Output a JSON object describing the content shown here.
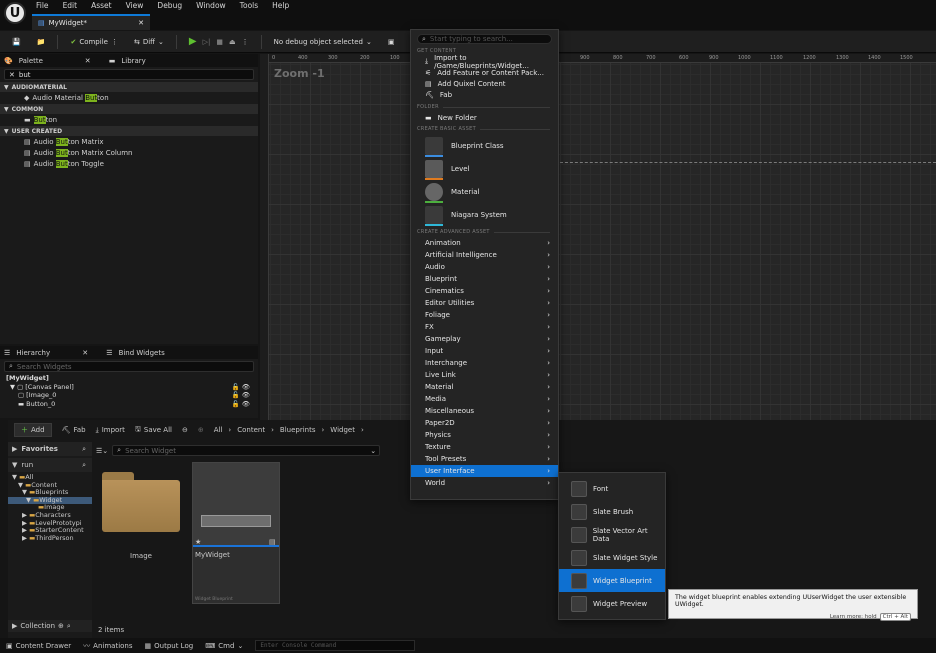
{
  "app": {
    "logo": "U",
    "menu": [
      "File",
      "Edit",
      "Asset",
      "View",
      "Debug",
      "Window",
      "Tools",
      "Help"
    ],
    "doc_tab": "MyWidget*"
  },
  "toolbar": {
    "compile": "Compile",
    "diff": "Diff",
    "debug_select": "No debug object selected"
  },
  "palette": {
    "title": "Palette",
    "library": "Library",
    "search": "but",
    "sections": [
      {
        "name": "AUDIOMATERIAL",
        "items": [
          {
            "pre": "Audio Material ",
            "hl": "But",
            "post": "ton"
          }
        ]
      },
      {
        "name": "COMMON",
        "items": [
          {
            "pre": "",
            "hl": "But",
            "post": "ton"
          }
        ]
      },
      {
        "name": "USER CREATED",
        "items": [
          {
            "pre": "Audio ",
            "hl": "But",
            "post": "ton Matrix"
          },
          {
            "pre": "Audio ",
            "hl": "But",
            "post": "ton Matrix Column"
          },
          {
            "pre": "Audio ",
            "hl": "But",
            "post": "ton Toggle"
          }
        ]
      }
    ]
  },
  "hierarchy": {
    "title": "Hierarchy",
    "bind": "Bind Widgets",
    "search_placeholder": "Search Widgets",
    "tree": [
      "[MyWidget]",
      "[Canvas Panel]",
      "[Image_0",
      "Button_0"
    ]
  },
  "designer": {
    "zoom": "Zoom -1",
    "ruler": [
      "0",
      "400",
      "300",
      "200",
      "100",
      "900",
      "800",
      "700",
      "600",
      "900",
      "1000",
      "1100",
      "1200",
      "1300",
      "1400",
      "1500"
    ]
  },
  "context_menu": {
    "search_placeholder": "Start typing to search...",
    "get_content_header": "GET CONTENT",
    "get_content": [
      "Import to /Game/Blueprints/Widget...",
      "Add Feature or Content Pack...",
      "Add Quixel Content",
      "Fab"
    ],
    "folder_header": "FOLDER",
    "new_folder": "New Folder",
    "basic_header": "CREATE BASIC ASSET",
    "basic": [
      "Blueprint Class",
      "Level",
      "Material",
      "Niagara System"
    ],
    "advanced_header": "CREATE ADVANCED ASSET",
    "advanced": [
      "Animation",
      "Artificial Intelligence",
      "Audio",
      "Blueprint",
      "Cinematics",
      "Editor Utilities",
      "Foliage",
      "FX",
      "Gameplay",
      "Input",
      "Interchange",
      "Live Link",
      "Material",
      "Media",
      "Miscellaneous",
      "Paper2D",
      "Physics",
      "Texture",
      "Tool Presets",
      "User Interface",
      "World"
    ],
    "highlighted": "User Interface"
  },
  "submenu": {
    "items": [
      "Font",
      "Slate Brush",
      "Slate Vector Art Data",
      "Slate Widget Style",
      "Widget Blueprint",
      "Widget Preview"
    ],
    "highlighted": "Widget Blueprint"
  },
  "tooltip": {
    "text": "The widget blueprint enables extending UUserWidget the user extensible UWidget.",
    "learn": "Learn more: hold",
    "keys": "Ctrl + Alt"
  },
  "content_browser": {
    "add": "Add",
    "fab": "Fab",
    "import": "Import",
    "save_all": "Save All",
    "path": [
      "All",
      "Content",
      "Blueprints",
      "Widget"
    ],
    "favorites": "Favorites",
    "filter_text": "run",
    "tree": [
      "All",
      "Content",
      "Blueprints",
      "Widget",
      "Image",
      "Characters",
      "LevelPrototypi",
      "StarterContent",
      "ThirdPerson"
    ],
    "search_placeholder": "Search Widget",
    "assets": [
      {
        "name": "Image",
        "type": ""
      },
      {
        "name": "MyWidget",
        "type": "Widget Blueprint"
      }
    ],
    "collection": "Collection",
    "count": "2 items"
  },
  "statusbar": {
    "content_drawer": "Content Drawer",
    "animations": "Animations",
    "output_log": "Output Log",
    "cmd": "Cmd",
    "console_placeholder": "Enter Console Command"
  },
  "colors": {
    "accent": "#0e70d1",
    "highlight": "#7db31d",
    "menu_bg": "#242424"
  }
}
